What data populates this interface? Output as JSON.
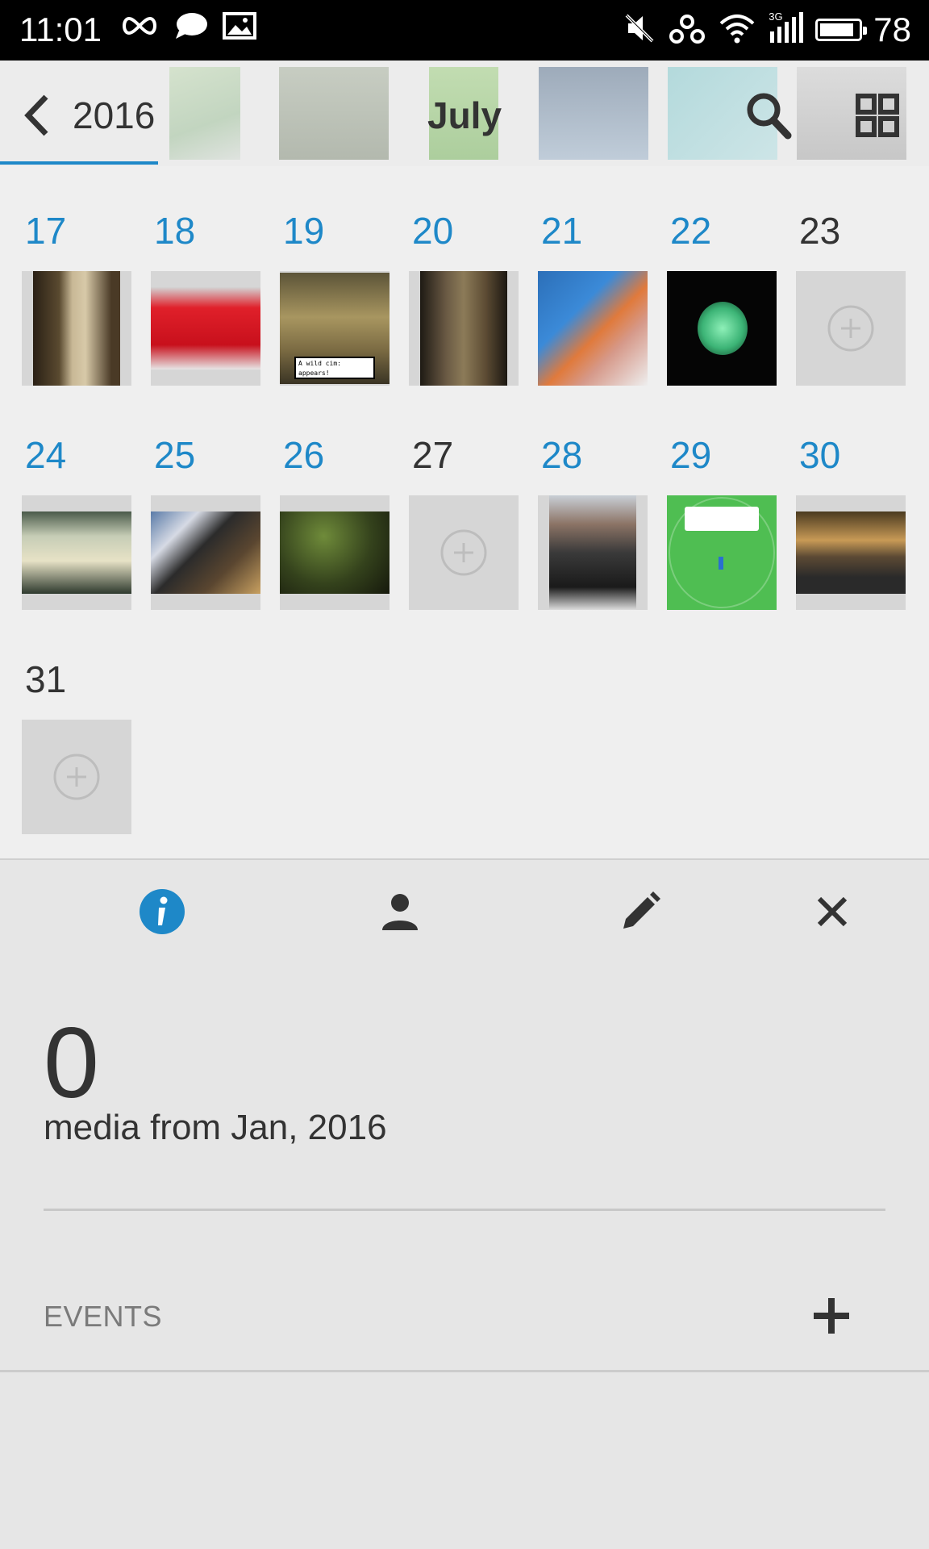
{
  "status_bar": {
    "time": "11:01",
    "left_icons": [
      "infinity-icon",
      "chat-bubble-icon",
      "image-icon"
    ],
    "right_icons": [
      "mute-icon",
      "vpn-icon",
      "wifi-icon",
      "signal-3g-icon",
      "battery-icon"
    ],
    "network": "3G",
    "battery_level": "78"
  },
  "header": {
    "year": "2016",
    "month": "July",
    "accent_color": "#1e88c8"
  },
  "calendar": {
    "rows": [
      [
        {
          "day": "17",
          "has_media": true
        },
        {
          "day": "18",
          "has_media": true
        },
        {
          "day": "19",
          "has_media": true,
          "photo_caption": "A wild cim: appears!"
        },
        {
          "day": "20",
          "has_media": true
        },
        {
          "day": "21",
          "has_media": true
        },
        {
          "day": "22",
          "has_media": true
        },
        {
          "day": "23",
          "has_media": false
        }
      ],
      [
        {
          "day": "24",
          "has_media": true
        },
        {
          "day": "25",
          "has_media": true
        },
        {
          "day": "26",
          "has_media": true
        },
        {
          "day": "27",
          "has_media": false
        },
        {
          "day": "28",
          "has_media": true
        },
        {
          "day": "29",
          "has_media": true
        },
        {
          "day": "30",
          "has_media": true
        }
      ],
      [
        {
          "day": "31",
          "has_media": false
        }
      ]
    ]
  },
  "panel": {
    "tabs": [
      "info-icon",
      "person-icon",
      "pencil-icon",
      "close-icon"
    ],
    "media_count": "0",
    "media_caption": "media from Jan, 2016",
    "events_label": "EVENTS"
  }
}
